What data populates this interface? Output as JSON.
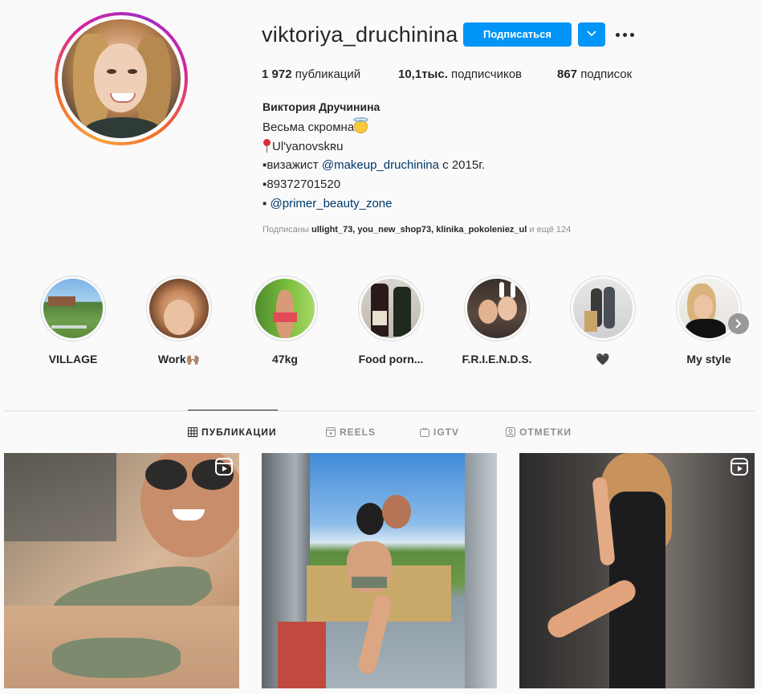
{
  "profile": {
    "username": "viktoriya_druchinina",
    "follow_label": "Подписаться",
    "stats": {
      "posts_count": "1 972",
      "posts_label": "публикаций",
      "followers_count": "10,1тыс.",
      "followers_label": "подписчиков",
      "following_count": "867",
      "following_label": "подписок"
    },
    "full_name": "Виктория Дручинина",
    "bio": {
      "line1": "Весьма скромна",
      "line2": "Ul'yanovskʀu",
      "line3_prefix": "▪визажист ",
      "line3_mention": "@makeup_druchinina",
      "line3_suffix": " с 2015г.",
      "line4": "▪89372701520",
      "line5_prefix": "▪ ",
      "line5_mention": "@primer_beauty_zone"
    },
    "followed_by": {
      "prefix": "Подписаны ",
      "names": "ullight_73, you_new_shop73, klinika_pokoleniez_ul",
      "suffix": " и ещё 124"
    }
  },
  "highlights": [
    {
      "label": "VILLAGE"
    },
    {
      "label": "Work🙌🏽"
    },
    {
      "label": "47kg"
    },
    {
      "label": "Food porn..."
    },
    {
      "label": "F.R.I.E.N.D.S."
    },
    {
      "label": "🖤"
    },
    {
      "label": "My style"
    }
  ],
  "tabs": [
    {
      "label": "ПУБЛИКАЦИИ",
      "icon": "grid-icon"
    },
    {
      "label": "REELS",
      "icon": "reels-icon"
    },
    {
      "label": "IGTV",
      "icon": "igtv-icon"
    },
    {
      "label": "ОТМЕТКИ",
      "icon": "tagged-icon"
    }
  ],
  "colors": {
    "accent": "#0095f6",
    "text": "#262626",
    "secondary_text": "#8e8e8e",
    "mention": "#00376b",
    "background": "#fafafa"
  }
}
